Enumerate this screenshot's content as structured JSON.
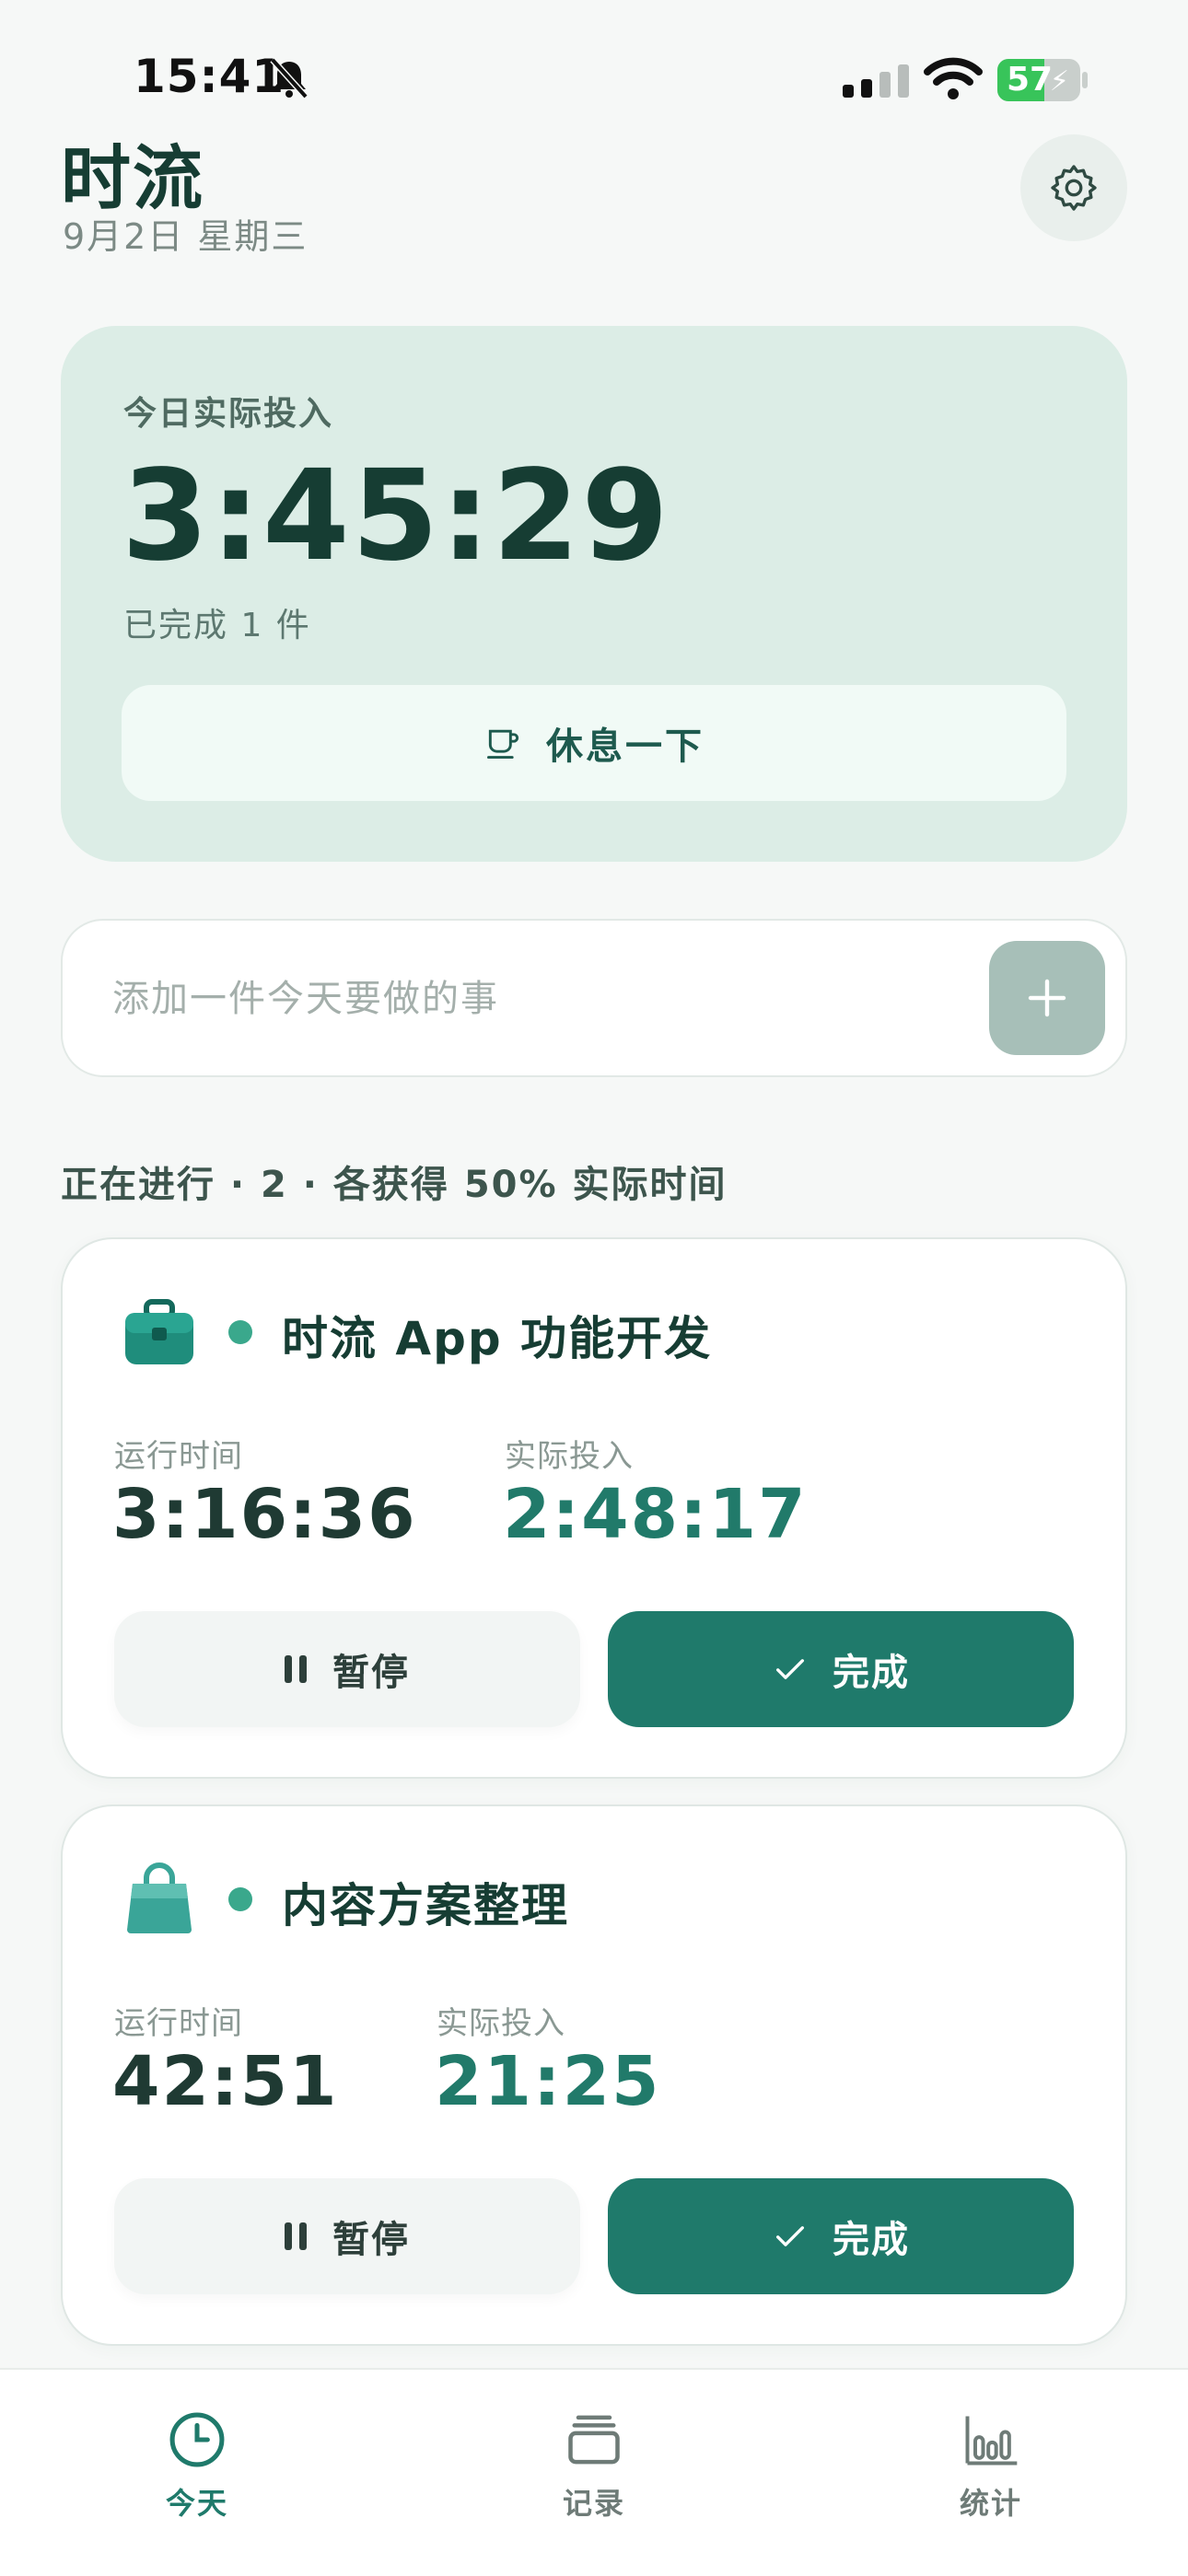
{
  "status_bar": {
    "time": "15:41",
    "battery": "57"
  },
  "header": {
    "title": "时流",
    "date": "9月2日 星期三"
  },
  "summary": {
    "label": "今日实际投入",
    "total_time": "3:45:29",
    "completed": "已完成 1 件",
    "rest_button": "休息一下"
  },
  "add_task": {
    "placeholder": "添加一件今天要做的事"
  },
  "section": {
    "heading": "正在进行 · 2 · 各获得 50% 实际时间"
  },
  "tasks": [
    {
      "title": "时流 App 功能开发",
      "icon": "briefcase-icon",
      "run_label": "运行时间",
      "run_time": "3:16:36",
      "actual_label": "实际投入",
      "actual_time": "2:48:17",
      "pause_label": "暂停",
      "done_label": "完成"
    },
    {
      "title": "内容方案整理",
      "icon": "shopping-bag-icon",
      "run_label": "运行时间",
      "run_time": "42:51",
      "actual_label": "实际投入",
      "actual_time": "21:25",
      "pause_label": "暂停",
      "done_label": "完成"
    }
  ],
  "tabbar": {
    "items": [
      {
        "label": "今天",
        "icon": "clock-icon",
        "active": true
      },
      {
        "label": "记录",
        "icon": "stack-icon",
        "active": false
      },
      {
        "label": "统计",
        "icon": "bar-chart-icon",
        "active": false
      }
    ]
  },
  "colors": {
    "accent": "#1f7a6b",
    "summary_bg": "#dcede6",
    "title": "#163d33",
    "active_value": "#217a6a",
    "status_dot": "#3aa88c"
  }
}
